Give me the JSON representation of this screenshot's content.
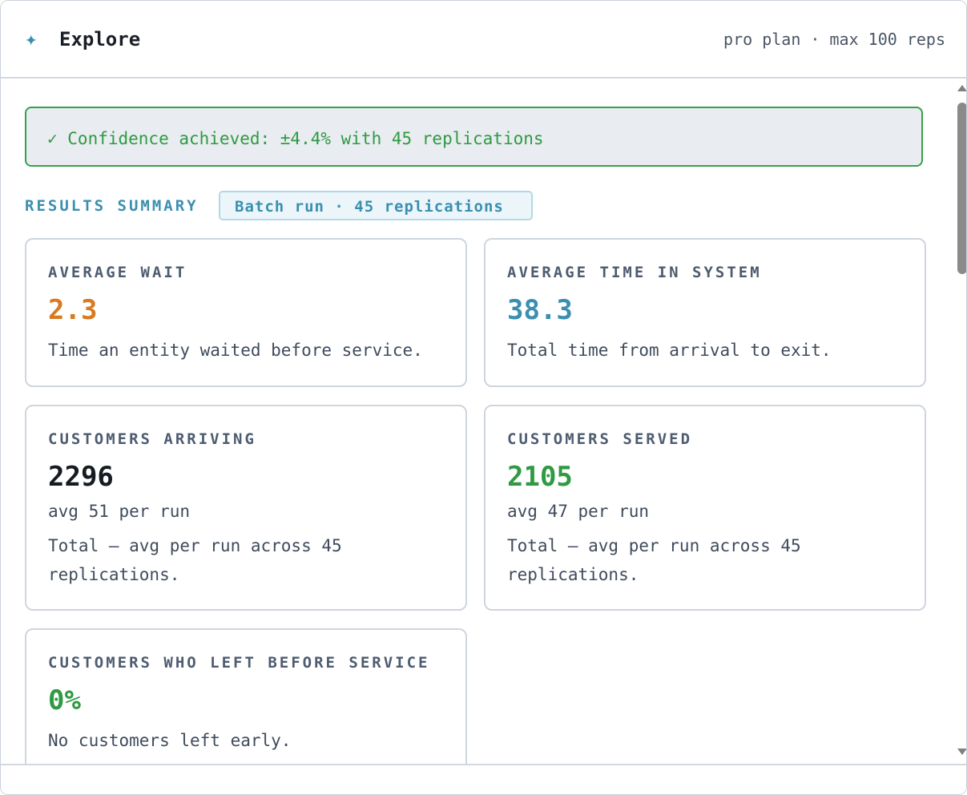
{
  "header": {
    "logo_icon": "✦",
    "title": "Explore",
    "plan_text": "pro plan · max 100 reps"
  },
  "banner": {
    "text": "✓ Confidence achieved: ±4.4% with 45 replications",
    "color": "#2f9a43"
  },
  "summary": {
    "label": "RESULTS SUMMARY",
    "badge": "Batch run · 45 replications"
  },
  "cards": [
    {
      "label": "AVERAGE WAIT",
      "value": "2.3",
      "value_color": "#d97a22",
      "description": "Time an entity waited before service."
    },
    {
      "label": "AVERAGE TIME IN SYSTEM",
      "value": "38.3",
      "value_color": "#3a8fb0",
      "description": "Total time from arrival to exit."
    },
    {
      "label": "CUSTOMERS ARRIVING",
      "value": "2296",
      "value_color": "#161b22",
      "sub": "avg 51 per run",
      "description": "Total — avg per run across 45 replications."
    },
    {
      "label": "CUSTOMERS SERVED",
      "value": "2105",
      "value_color": "#2f9a43",
      "sub": "avg 47 per run",
      "description": "Total — avg per run across 45 replications."
    },
    {
      "label": "CUSTOMERS WHO LEFT BEFORE SERVICE",
      "value": "0%",
      "value_color": "#2f9a43",
      "description": "No customers left early."
    }
  ],
  "colors": {
    "accent": "#3a8fb0",
    "success": "#2f9a43",
    "warning": "#d97a22"
  }
}
